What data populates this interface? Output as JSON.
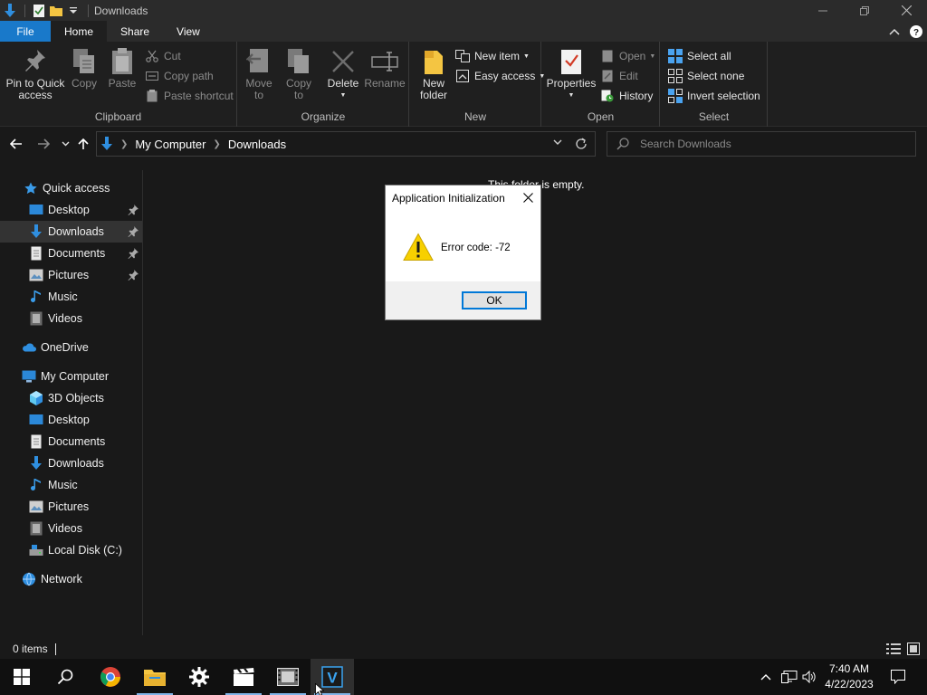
{
  "window": {
    "title": "Downloads"
  },
  "tabs": {
    "file": "File",
    "home": "Home",
    "share": "Share",
    "view": "View"
  },
  "ribbon": {
    "clipboard": {
      "label": "Clipboard",
      "pin_line1": "Pin to Quick",
      "pin_line2": "access",
      "copy": "Copy",
      "paste": "Paste",
      "cut": "Cut",
      "copy_path": "Copy path",
      "paste_shortcut": "Paste shortcut"
    },
    "organize": {
      "label": "Organize",
      "move_line1": "Move",
      "move_line2": "to",
      "copy_line1": "Copy",
      "copy_line2": "to",
      "delete": "Delete",
      "rename": "Rename"
    },
    "new": {
      "label": "New",
      "folder_line1": "New",
      "folder_line2": "folder",
      "new_item": "New item",
      "easy_access": "Easy access"
    },
    "open": {
      "label": "Open",
      "properties": "Properties",
      "open": "Open",
      "edit": "Edit",
      "history": "History"
    },
    "select": {
      "label": "Select",
      "select_all": "Select all",
      "select_none": "Select none",
      "invert": "Invert selection"
    }
  },
  "address": {
    "crumbs": [
      "My Computer",
      "Downloads"
    ],
    "search_placeholder": "Search Downloads"
  },
  "navpane": {
    "quick_access": "Quick access",
    "quick_items": [
      "Desktop",
      "Downloads",
      "Documents",
      "Pictures",
      "Music",
      "Videos"
    ],
    "onedrive": "OneDrive",
    "my_computer": "My Computer",
    "computer_items": [
      "3D Objects",
      "Desktop",
      "Documents",
      "Downloads",
      "Music",
      "Pictures",
      "Videos",
      "Local Disk (C:)"
    ],
    "network": "Network"
  },
  "content": {
    "empty_message": "This folder is empty."
  },
  "status": {
    "item_count": "0 items"
  },
  "dialog": {
    "title": "Application Initialization",
    "message": "Error code: -72",
    "ok": "OK"
  },
  "taskbar": {
    "time": "7:40 AM",
    "date": "4/22/2023",
    "pinned": [
      "windows-start",
      "search",
      "chrome",
      "file-explorer",
      "settings",
      "media-player",
      "video-editor",
      "v-app"
    ]
  },
  "colors": {
    "accent": "#1979ca",
    "folder_yellow": "#f4c542",
    "download_blue": "#2f8fe0",
    "warning_yellow": "#f7d000"
  }
}
